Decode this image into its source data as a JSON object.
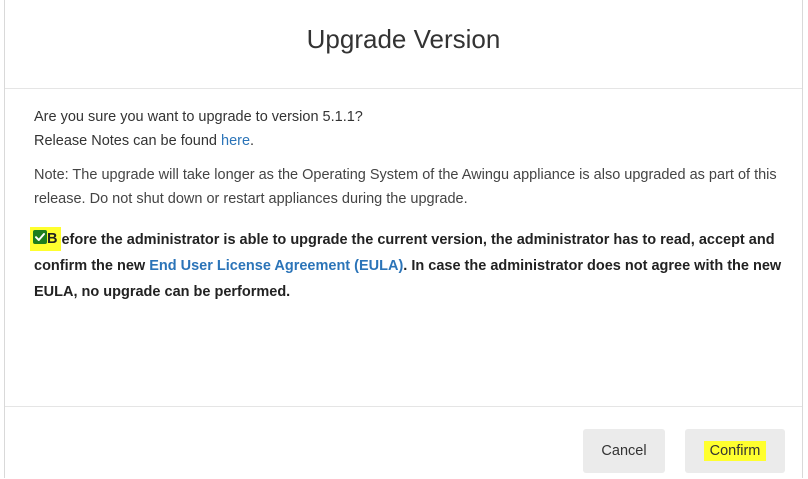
{
  "dialog": {
    "title": "Upgrade Version",
    "intro_line1": "Are you sure you want to upgrade to version 5.1.1?",
    "intro_line2_prefix": "Release Notes can be found ",
    "release_notes_link": "here",
    "intro_line2_suffix": ".",
    "note": "Note: The upgrade will take longer as the Operating System of the Awingu appliance is also upgraded as part of this release. Do not shut down or restart appliances during the upgrade.",
    "eula": {
      "checked": true,
      "first_letter": "B",
      "text_part1": "efore the administrator is able to upgrade the current version, the administrator has to read, accept and confirm the new ",
      "link": "End User License Agreement (EULA)",
      "text_part2": ". In case the administrator does not agree with the new EULA, no upgrade can be performed."
    },
    "buttons": {
      "cancel": "Cancel",
      "confirm": "Confirm"
    }
  },
  "colors": {
    "highlight": "#ffff2e",
    "link": "#2b74b8",
    "checkbox": "#1e7e1e",
    "button_bg": "#ebebeb"
  }
}
